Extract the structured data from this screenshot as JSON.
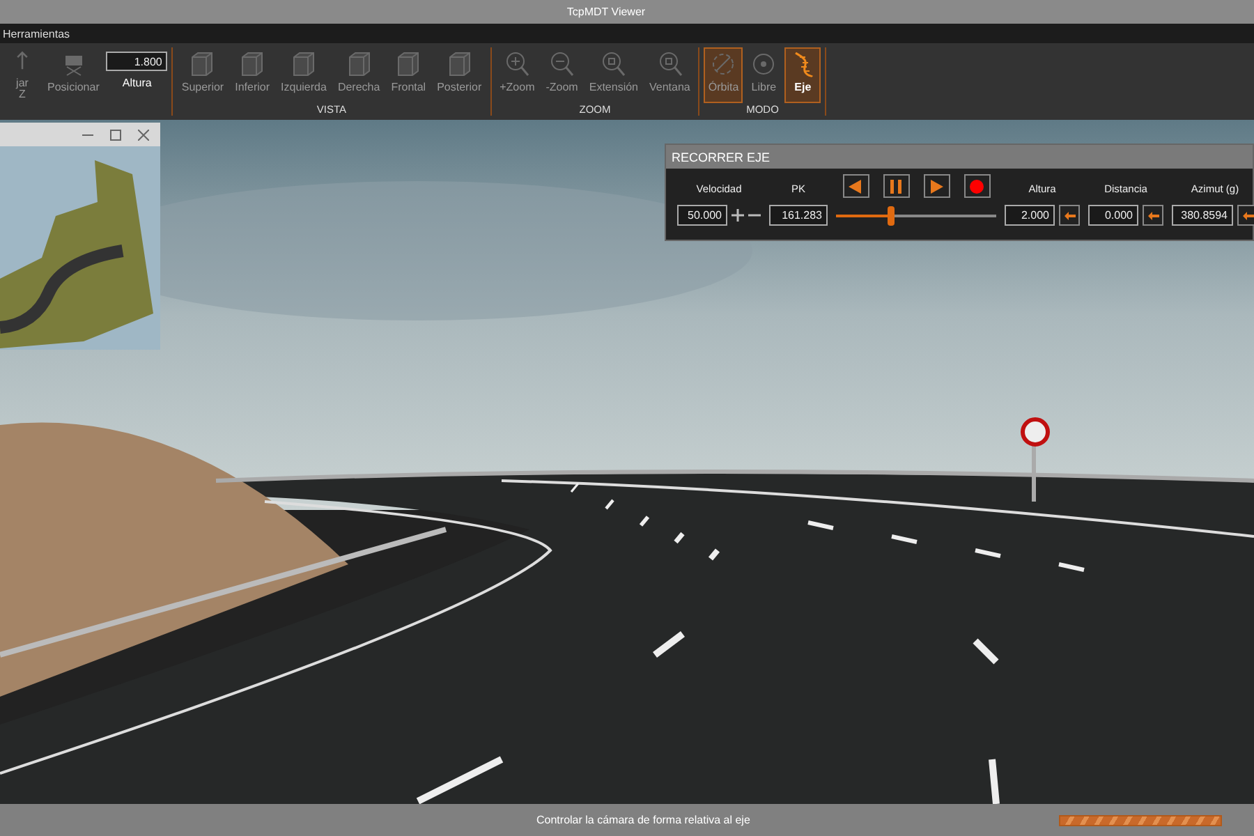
{
  "window": {
    "title": "TcpMDT Viewer"
  },
  "menu": [
    {
      "label": "Herramientas"
    }
  ],
  "ribbon": {
    "groups": [
      {
        "items": [
          {
            "kind": "tool",
            "label": "jar",
            "label2": "Z",
            "disabled": true
          },
          {
            "kind": "tool",
            "label": "Posicionar",
            "disabled": true
          },
          {
            "kind": "field",
            "value": "1.800",
            "label": "Altura"
          }
        ]
      },
      {
        "title": "VISTA",
        "items": [
          {
            "kind": "tool",
            "label": "Superior",
            "disabled": true
          },
          {
            "kind": "tool",
            "label": "Inferior",
            "disabled": true
          },
          {
            "kind": "tool",
            "label": "Izquierda",
            "disabled": true
          },
          {
            "kind": "tool",
            "label": "Derecha",
            "disabled": true
          },
          {
            "kind": "tool",
            "label": "Frontal",
            "disabled": true
          },
          {
            "kind": "tool",
            "label": "Posterior",
            "disabled": true
          }
        ]
      },
      {
        "title": "ZOOM",
        "items": [
          {
            "kind": "tool",
            "label": "+Zoom",
            "disabled": true
          },
          {
            "kind": "tool",
            "label": "-Zoom",
            "disabled": true
          },
          {
            "kind": "tool",
            "label": "Extensión",
            "disabled": true
          },
          {
            "kind": "tool",
            "label": "Ventana",
            "disabled": true
          }
        ]
      },
      {
        "title": "MODO",
        "items": [
          {
            "kind": "mode",
            "label": "Órbita",
            "selected": true,
            "disabled": true
          },
          {
            "kind": "mode",
            "label": "Libre",
            "selected": false,
            "disabled": true
          },
          {
            "kind": "mode",
            "label": "Eje",
            "selected": true,
            "disabled": false
          }
        ]
      }
    ]
  },
  "axis_panel": {
    "title": "RECORRER EJE",
    "velocity": {
      "label": "Velocidad",
      "value": "50.000"
    },
    "pk": {
      "label": "PK",
      "value": "161.283",
      "level": 0.34
    },
    "playback": [
      {
        "kind": "prev"
      },
      {
        "kind": "pause"
      },
      {
        "kind": "next"
      },
      {
        "kind": "record"
      }
    ],
    "fields": [
      {
        "label": "Altura",
        "value": "2.000"
      },
      {
        "label": "Distancia",
        "value": "0.000"
      },
      {
        "label": "Azimut (g)",
        "value": "380.8594"
      }
    ]
  },
  "status_bar": {
    "message": "Controlar la cámara de forma relativa al eje",
    "level": 1
  }
}
